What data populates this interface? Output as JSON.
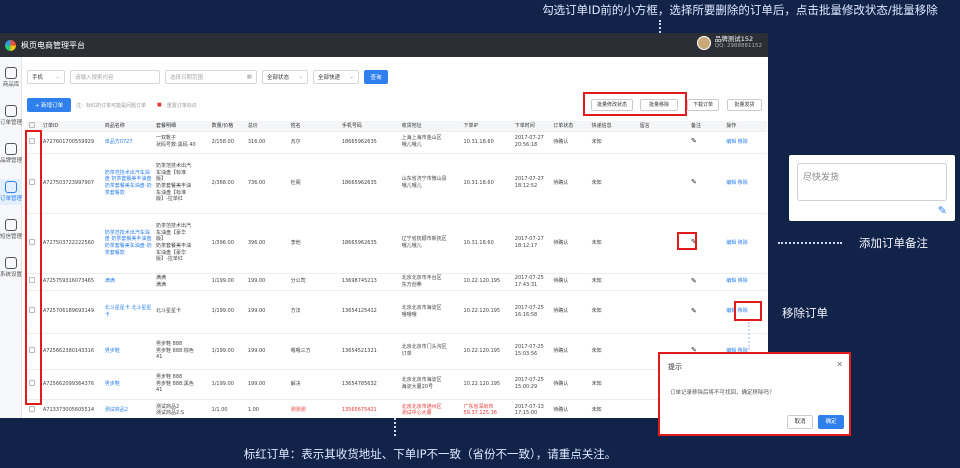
{
  "annotations": {
    "top": "勾选订单ID前的小方框，选择所要删除的订单后，点击批量修改状态/批量移除",
    "remark": "添加订单备注",
    "remove": "移除订单",
    "bottom": "标红订单：表示其收货地址、下单IP不一致（省份不一致），请重点关注。"
  },
  "app": {
    "title": "枫页电商管理平台",
    "user_name": "品牌测试152",
    "user_qq": "QQ: 2988881152"
  },
  "sidebar": [
    {
      "label": "商品库",
      "icon": "box-icon"
    },
    {
      "label": "订单管理",
      "icon": "list-icon"
    },
    {
      "label": "品牌管理",
      "icon": "chart-icon"
    },
    {
      "label": "订单管理",
      "icon": "table-icon"
    },
    {
      "label": "短信管理",
      "icon": "message-icon"
    },
    {
      "label": "系统设置",
      "icon": "gear-icon"
    }
  ],
  "filters": {
    "type": "手机",
    "keyword_placeholder": "请输入搜索内容",
    "date_placeholder": "选择日期范围",
    "status": "全部状态",
    "logistics": "全部快递",
    "search_btn": "查询"
  },
  "toolbar": {
    "new_order": "+ 新增订单",
    "hint": "注：标红的订单可能是问题订单",
    "flag": "重置订单标识",
    "batch_status": "批量修改状态",
    "batch_remove": "批量移除",
    "download": "下载订单",
    "batch_ship": "批量发货"
  },
  "columns": [
    "订单ID",
    "商品名称",
    "套餐明细",
    "数量/价格",
    "总价",
    "姓名",
    "手机号码",
    "收货地址",
    "下单IP",
    "下单时间",
    "订单状态",
    "快递信息",
    "留言",
    "备注",
    "操作"
  ],
  "rows": [
    {
      "id": "A727601700559929",
      "product": "单品方0727",
      "pkg": [
        "一双靴子",
        "状码号数:黑码 40"
      ],
      "qty": "2/158.00",
      "total": "316.00",
      "name": "瓦尔",
      "phone": "18665962635",
      "addr": [
        "上海上海市金山区",
        "哦儿哦儿"
      ],
      "ip": "10.31.18.60",
      "time": [
        "2017-07-27",
        "20:56:18"
      ],
      "status": "待确认",
      "express": "未知",
      "red": false
    },
    {
      "id": "A727503723997907",
      "product": "奶茶范技术出汽车油盘 奶茶套餐美丰油盘 奶茶套餐美车油盘-奶茶套餐款",
      "pkg": [
        "奶茶范技术出汽",
        "车油盘【标准",
        "版】",
        "奶茶套餐美丰油",
        "车油盘【标准",
        "版】-拉单红"
      ],
      "qty": "2/368.00",
      "total": "736.00",
      "name": "杜阁",
      "phone": "18665962635",
      "addr": [
        "山东省济宁市微山县",
        "哦儿哦儿"
      ],
      "ip": "10.31.18.60",
      "time": [
        "2017-07-27",
        "18:12:52"
      ],
      "status": "待确认",
      "express": "未知",
      "red": false
    },
    {
      "id": "A727503722222560",
      "product": "奶茶范技术出汽车油盘 奶茶套餐美丰油盘 奶茶套餐美车油盘-奶茶套餐款",
      "pkg": [
        "奶茶范技术出汽",
        "车油盘【豪华",
        "版】",
        "奶茶套餐美丰油",
        "车油盘【豪华",
        "版】-拉单红"
      ],
      "qty": "1/396.00",
      "total": "396.00",
      "name": "李他",
      "phone": "18665962635",
      "addr": [
        "辽宁省抚顺市新抚区",
        "哦儿哦儿"
      ],
      "ip": "10.31.18.60",
      "time": [
        "2017-07-27",
        "18:12:17"
      ],
      "status": "待确认",
      "express": "未知",
      "red": false
    },
    {
      "id": "A725759316073465",
      "product": "满满",
      "pkg": [
        "满满",
        "满满"
      ],
      "qty": "1/199.00",
      "total": "199.00",
      "name": "分公司",
      "phone": "13698745213",
      "addr": [
        "北京北京市丰台区",
        "东方创拳"
      ],
      "ip": "10.22.120.195",
      "time": [
        "2017-07-25",
        "17:43:31"
      ],
      "status": "待确认",
      "express": "未知",
      "red": false
    },
    {
      "id": "A725706189693149",
      "product": "北斗星星卡 北斗星星卡",
      "pkg": [
        "北斗星星卡"
      ],
      "qty": "1/199.00",
      "total": "199.00",
      "name": "方法",
      "phone": "13654125412",
      "addr": [
        "北京北京市海淀区",
        "哦哦哦"
      ],
      "ip": "10.22.120.195",
      "time": [
        "2017-07-25",
        "16:16:58"
      ],
      "status": "待确认",
      "express": "未知",
      "red": false
    },
    {
      "id": "A725662380143316",
      "product": "男步鞋",
      "pkg": [
        "男步鞋 888",
        "男步鞋 888:棕色",
        "41"
      ],
      "qty": "1/199.00",
      "total": "199.00",
      "name": "嗯嗯三方",
      "phone": "13654521321",
      "addr": [
        "北京北京市门头沟区",
        "订单"
      ],
      "ip": "10.22.120.195",
      "time": [
        "2017-07-25",
        "15:03:56"
      ],
      "status": "待确认",
      "express": "未知",
      "red": false
    },
    {
      "id": "A725662099364376",
      "product": "男步鞋",
      "pkg": [
        "男步鞋 888",
        "男步鞋 888:黑色",
        "41"
      ],
      "qty": "1/199.00",
      "total": "199.00",
      "name": "解决",
      "phone": "13654785632",
      "addr": [
        "北京北京市海淀区",
        "海淀大厦20号"
      ],
      "ip": "10.22.120.195",
      "time": [
        "2017-07-25",
        "15:00:29"
      ],
      "status": "待确认",
      "express": "未知",
      "red": false
    },
    {
      "id": "A713373005605514",
      "product": "测试商品2",
      "pkg": [
        "测试商品2",
        "测试商品2:S"
      ],
      "qty": "1/1.00",
      "total": "1.00",
      "name": "测测测",
      "phone": "13565675421",
      "addr": [
        "北京北京市通州区",
        "测试中心大厦"
      ],
      "ip": [
        "广东省深圳市",
        "59.37.125.36"
      ],
      "time": [
        "2017-07-13",
        "17:15:00"
      ],
      "status": "待确认",
      "express": "未知",
      "red": true
    }
  ],
  "row_actions": {
    "edit": "编辑",
    "remove": "移除"
  },
  "remark_panel": {
    "text": "尽快发货"
  },
  "modal": {
    "title": "提示",
    "message": "订单记录移除后将不可找回，确定移除吗？",
    "cancel": "取消",
    "ok": "确定"
  }
}
